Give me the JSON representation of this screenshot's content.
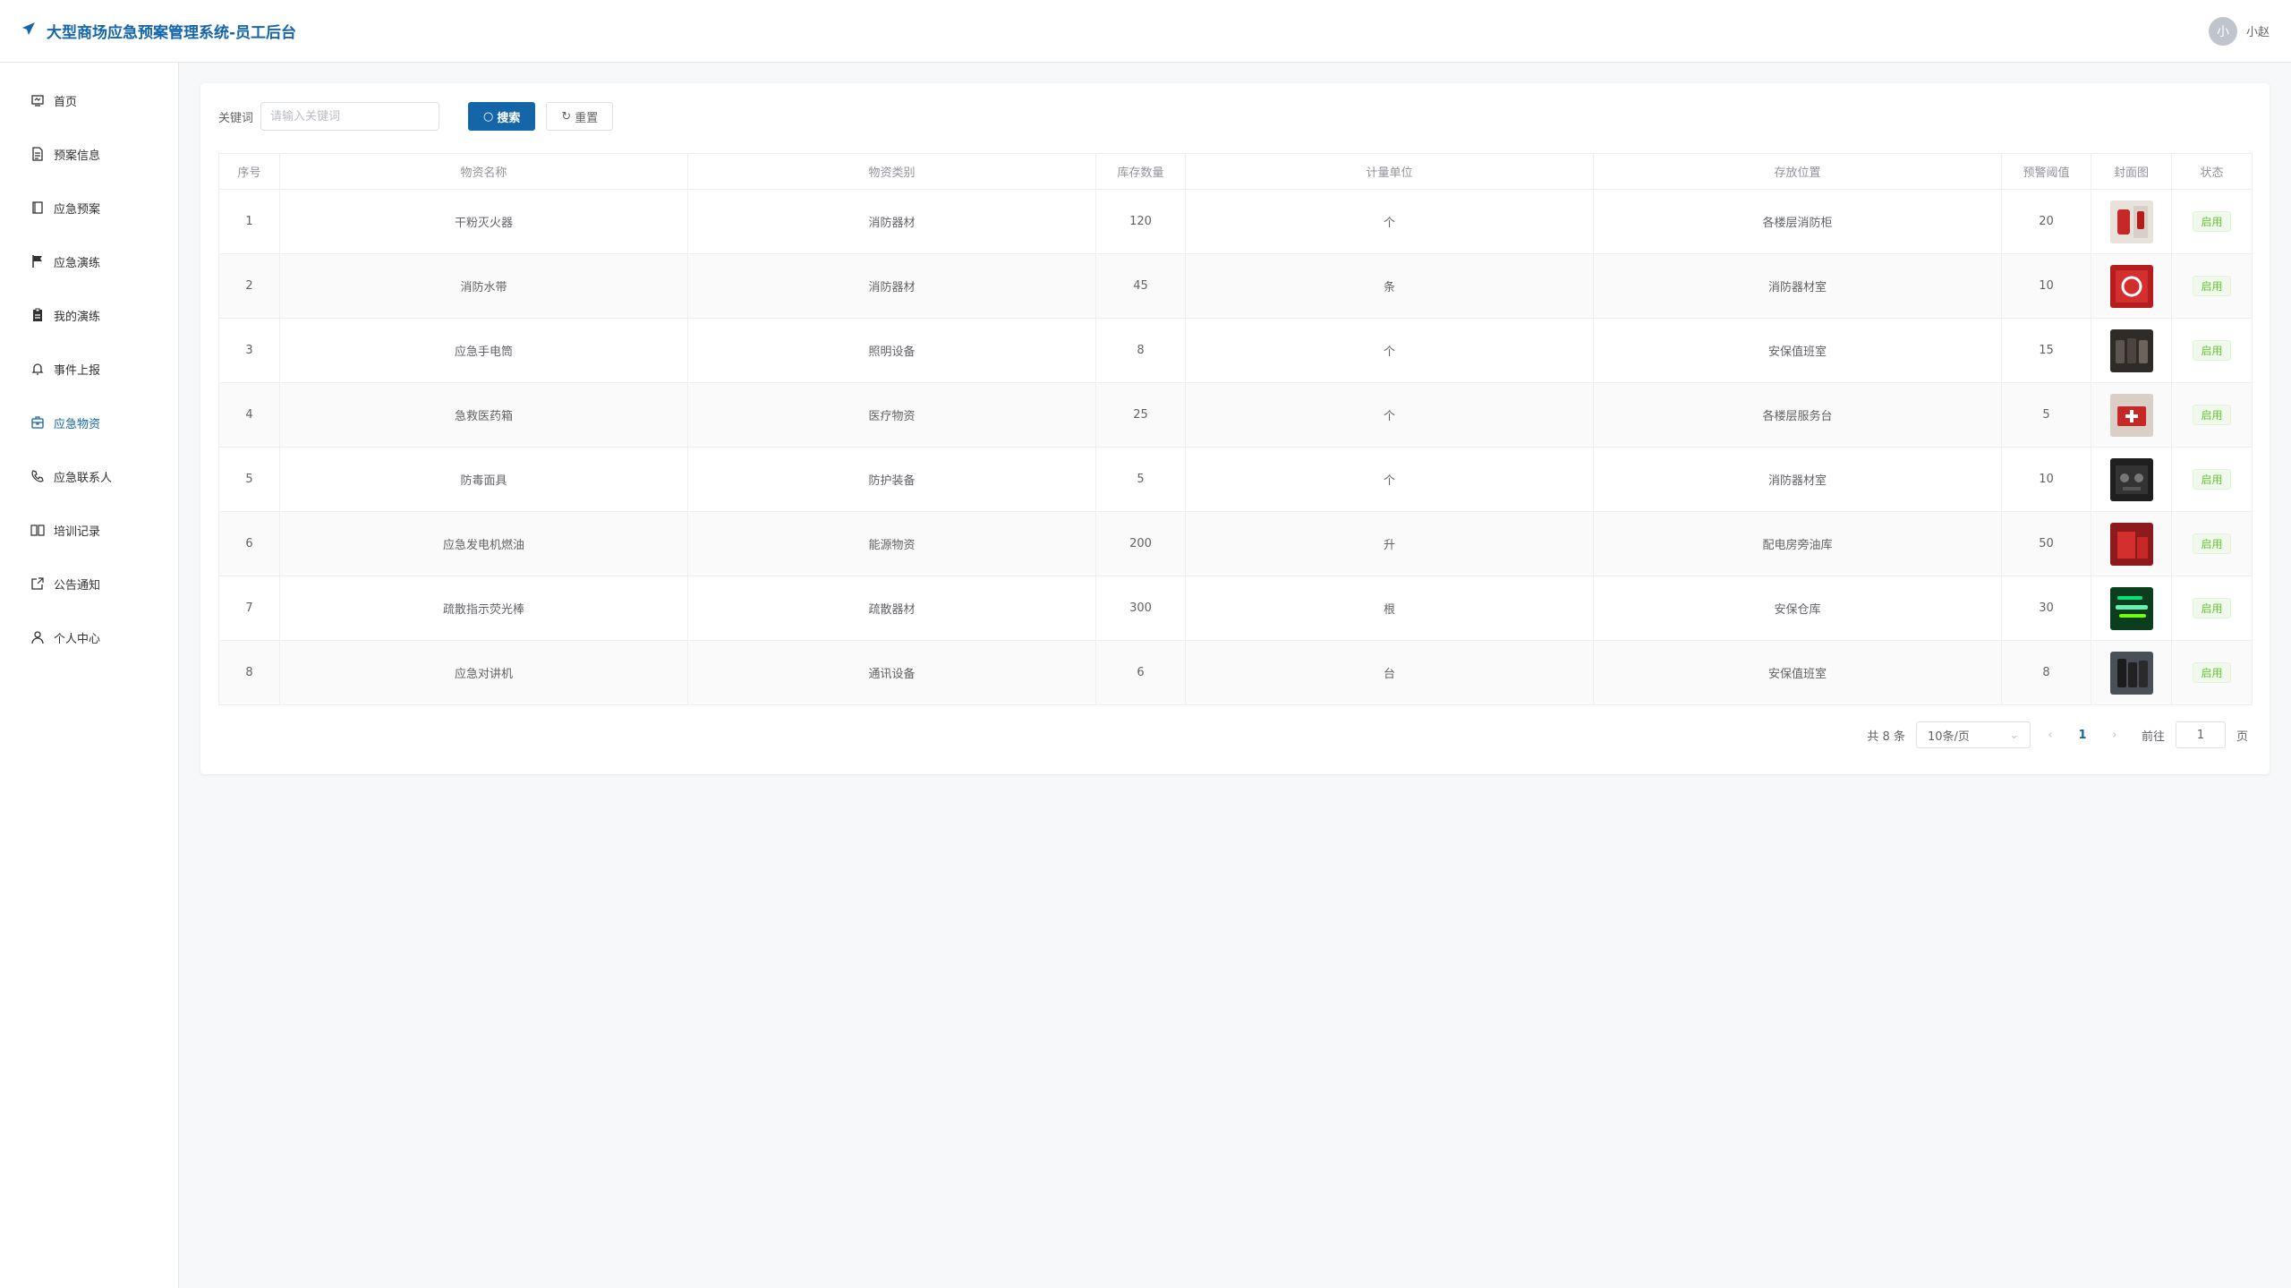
{
  "header": {
    "title": "大型商场应急预案管理系统-员工后台",
    "avatar_text": "小",
    "username": "小赵"
  },
  "sidebar": {
    "items": [
      {
        "label": "首页",
        "icon": "home-icon"
      },
      {
        "label": "预案信息",
        "icon": "document-icon"
      },
      {
        "label": "应急预案",
        "icon": "book-icon"
      },
      {
        "label": "应急演练",
        "icon": "flag-icon"
      },
      {
        "label": "我的演练",
        "icon": "clipboard-icon"
      },
      {
        "label": "事件上报",
        "icon": "bell-icon"
      },
      {
        "label": "应急物资",
        "icon": "box-icon",
        "active": true
      },
      {
        "label": "应急联系人",
        "icon": "phone-icon"
      },
      {
        "label": "培训记录",
        "icon": "book-open-icon"
      },
      {
        "label": "公告通知",
        "icon": "external-icon"
      },
      {
        "label": "个人中心",
        "icon": "user-icon"
      }
    ]
  },
  "filter": {
    "label": "关键词",
    "placeholder": "请输入关键词",
    "search_label": "搜索",
    "reset_label": "重置"
  },
  "table": {
    "headers": [
      "序号",
      "物资名称",
      "物资类别",
      "库存数量",
      "计量单位",
      "存放位置",
      "预警阈值",
      "封面图",
      "状态"
    ],
    "rows": [
      {
        "no": "1",
        "name": "干粉灭火器",
        "category": "消防器材",
        "qty": "120",
        "unit": "个",
        "location": "各楼层消防柜",
        "threshold": "20",
        "status": "启用"
      },
      {
        "no": "2",
        "name": "消防水带",
        "category": "消防器材",
        "qty": "45",
        "unit": "条",
        "location": "消防器材室",
        "threshold": "10",
        "status": "启用"
      },
      {
        "no": "3",
        "name": "应急手电筒",
        "category": "照明设备",
        "qty": "8",
        "unit": "个",
        "location": "安保值班室",
        "threshold": "15",
        "status": "启用"
      },
      {
        "no": "4",
        "name": "急救医药箱",
        "category": "医疗物资",
        "qty": "25",
        "unit": "个",
        "location": "各楼层服务台",
        "threshold": "5",
        "status": "启用"
      },
      {
        "no": "5",
        "name": "防毒面具",
        "category": "防护装备",
        "qty": "5",
        "unit": "个",
        "location": "消防器材室",
        "threshold": "10",
        "status": "启用"
      },
      {
        "no": "6",
        "name": "应急发电机燃油",
        "category": "能源物资",
        "qty": "200",
        "unit": "升",
        "location": "配电房旁油库",
        "threshold": "50",
        "status": "启用"
      },
      {
        "no": "7",
        "name": "疏散指示荧光棒",
        "category": "疏散器材",
        "qty": "300",
        "unit": "根",
        "location": "安保仓库",
        "threshold": "30",
        "status": "启用"
      },
      {
        "no": "8",
        "name": "应急对讲机",
        "category": "通讯设备",
        "qty": "6",
        "unit": "台",
        "location": "安保值班室",
        "threshold": "8",
        "status": "启用"
      }
    ]
  },
  "pagination": {
    "total": "共 8 条",
    "page_size": "10条/页",
    "current": "1",
    "goto_label": "前往",
    "goto_value": "1",
    "page_suffix": "页"
  },
  "colors": {
    "primary": "#1565a9",
    "success": "#67c23a"
  }
}
